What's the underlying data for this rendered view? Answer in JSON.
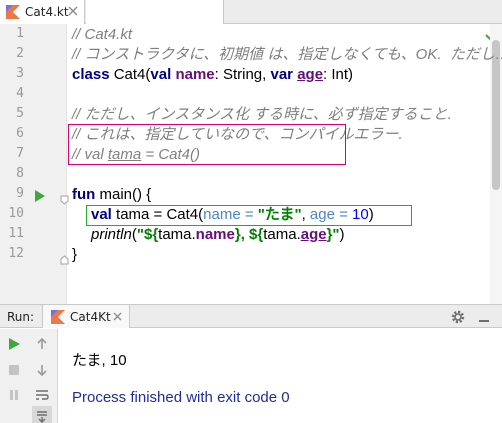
{
  "editor": {
    "tab_label": "Cat4.kt",
    "line_numbers": [
      "1",
      "2",
      "3",
      "4",
      "5",
      "6",
      "7",
      "8",
      "9",
      "10",
      "11",
      "12"
    ],
    "lines": {
      "l1": "// Cat4.kt",
      "l2": "// コンストラクタに、初期値 は、指定しなくても、OK.  ただし…",
      "l3": {
        "kw1": "class",
        "t1": " Cat4(",
        "kw2": "val",
        "t2": " ",
        "p1": "name",
        "t3": ": String, ",
        "kw3": "var",
        "t4": " ",
        "p2": "age",
        "t5": ": Int)"
      },
      "l5": "// ただし、インスタンス化 する時に、必ず指定すること.",
      "l6": "// これは、指定していなので、コンパイルエラー.",
      "l7": {
        "a": "// val ",
        "b": "tama",
        "c": " = Cat4()"
      },
      "l9": {
        "kw": "fun",
        "t": " main() {"
      },
      "l10": {
        "kw": "val",
        "t1": " tama = Cat4(",
        "n1": "name = ",
        "s": "\"たま\"",
        "t2": ", ",
        "n2": "age = ",
        "num": "10",
        "t3": ")"
      },
      "l11": {
        "fn": "println",
        "t1": "(",
        "s1": "\"${",
        "t2": "tama.",
        "p1": "name",
        "s2": "}, ${",
        "t3": "tama.",
        "p2": "age",
        "s3": "}\"",
        "t4": ")"
      },
      "l12": "}"
    }
  },
  "run": {
    "label": "Run:",
    "tab_label": "Cat4Kt",
    "output": "たま, 10",
    "status": "Process finished with exit code 0"
  },
  "colors": {
    "keyword": "#000080",
    "property": "#660e7a",
    "string": "#008000",
    "comment": "#7f7f7f",
    "param_hint": "#4a86c8",
    "number": "#0000ff",
    "highlight_magenta": "#d6007a",
    "highlight_green": "#22b022"
  },
  "icons": [
    "kotlin-file-icon",
    "close-icon",
    "check-icon",
    "run-gutter-icon",
    "fold-icon",
    "gear-icon",
    "hide-icon",
    "rerun-icon",
    "stop-icon",
    "pause-icon",
    "up-arrow-icon",
    "down-arrow-icon",
    "soft-wrap-icon",
    "scroll-end-icon"
  ]
}
